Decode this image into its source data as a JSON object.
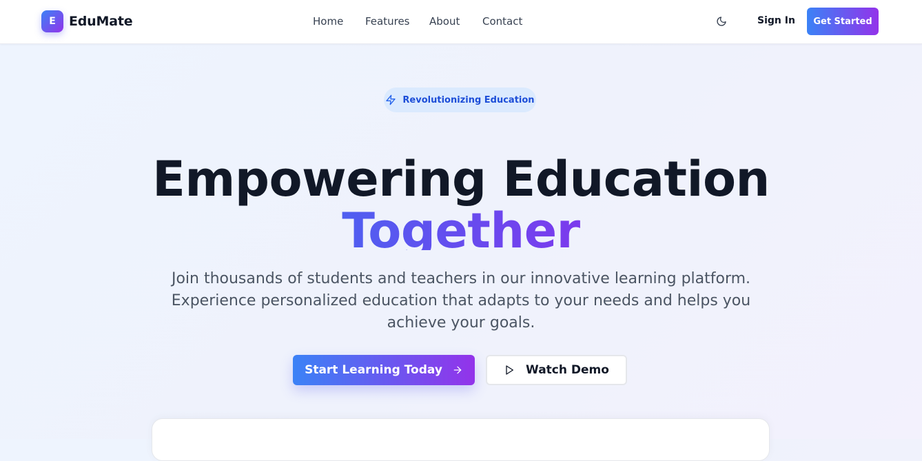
{
  "brand": {
    "logo_letter": "E",
    "name": "EduMate"
  },
  "nav": {
    "items": [
      {
        "label": "Home"
      },
      {
        "label": "Features"
      },
      {
        "label": "About"
      },
      {
        "label": "Contact"
      }
    ]
  },
  "header_actions": {
    "theme_icon": "moon-icon",
    "sign_in": "Sign In",
    "get_started": "Get Started"
  },
  "hero": {
    "badge_icon": "lightning-icon",
    "badge": "Revolutionizing Education",
    "headline": "Empowering Education",
    "headline_accent": "Together",
    "subtitle": "Join thousands of students and teachers in our innovative learning platform. Experience personalized education that adapts to your needs and helps you achieve your goals.",
    "primary_cta": "Start Learning Today",
    "primary_cta_icon": "arrow-right-icon",
    "secondary_cta": "Watch Demo",
    "secondary_cta_icon": "play-icon"
  },
  "colors": {
    "accent_start": "#3b82f6",
    "accent_end": "#9333ea",
    "badge_bg": "#dbeafe",
    "badge_text": "#1d4ed8",
    "heading": "#111827"
  }
}
